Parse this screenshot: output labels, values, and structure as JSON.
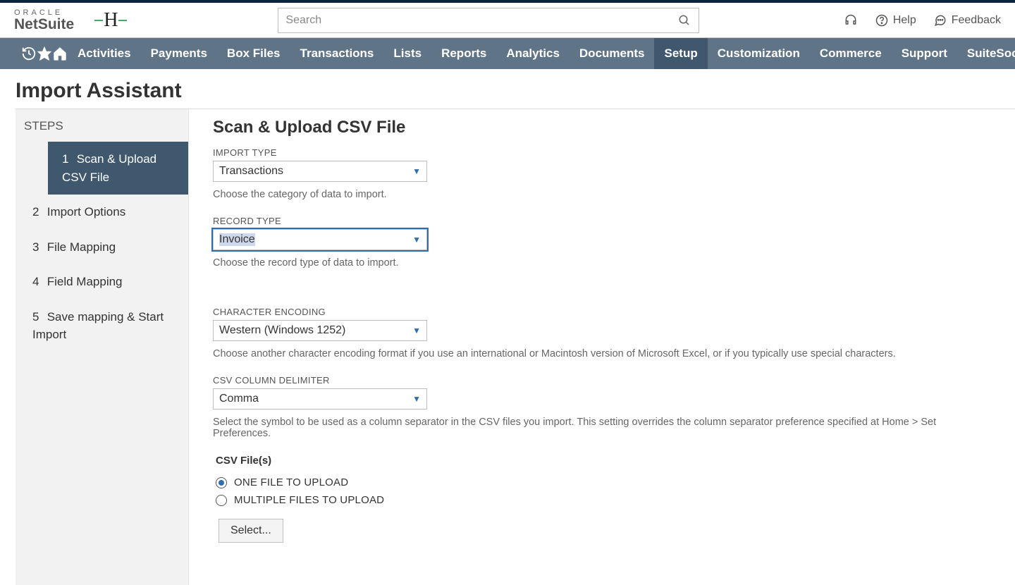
{
  "brand": {
    "line1": "ORACLE",
    "line2": "NetSuite"
  },
  "search": {
    "placeholder": "Search"
  },
  "header_links": {
    "help": "Help",
    "feedback": "Feedback"
  },
  "nav": {
    "items": [
      "Activities",
      "Payments",
      "Box Files",
      "Transactions",
      "Lists",
      "Reports",
      "Analytics",
      "Documents",
      "Setup",
      "Customization",
      "Commerce",
      "Support",
      "SuiteSocial"
    ],
    "active_index": 8
  },
  "page_title": "Import Assistant",
  "steps": {
    "title": "STEPS",
    "items": [
      "Scan & Upload CSV File",
      "Import Options",
      "File Mapping",
      "Field Mapping",
      "Save mapping & Start Import"
    ],
    "active_index": 0
  },
  "content": {
    "section_title": "Scan & Upload CSV File",
    "fields": {
      "import_type": {
        "label": "IMPORT TYPE",
        "value": "Transactions",
        "helper": "Choose the category of data to import."
      },
      "record_type": {
        "label": "RECORD TYPE",
        "value": "Invoice",
        "helper": "Choose the record type of data to import."
      },
      "char_encoding": {
        "label": "CHARACTER ENCODING",
        "value": "Western (Windows 1252)",
        "helper": "Choose another character encoding format if you use an international or Macintosh version of Microsoft Excel, or if you typically use special characters."
      },
      "csv_delimiter": {
        "label": "CSV COLUMN DELIMITER",
        "value": "Comma",
        "helper": "Select the symbol to be used as a column separator in the CSV files you import. This setting overrides the column separator preference specified at Home > Set Preferences."
      }
    },
    "csv_files": {
      "title": "CSV File(s)",
      "options": [
        "ONE FILE TO UPLOAD",
        "MULTIPLE FILES TO UPLOAD"
      ],
      "selected_index": 0,
      "select_button": "Select..."
    }
  }
}
